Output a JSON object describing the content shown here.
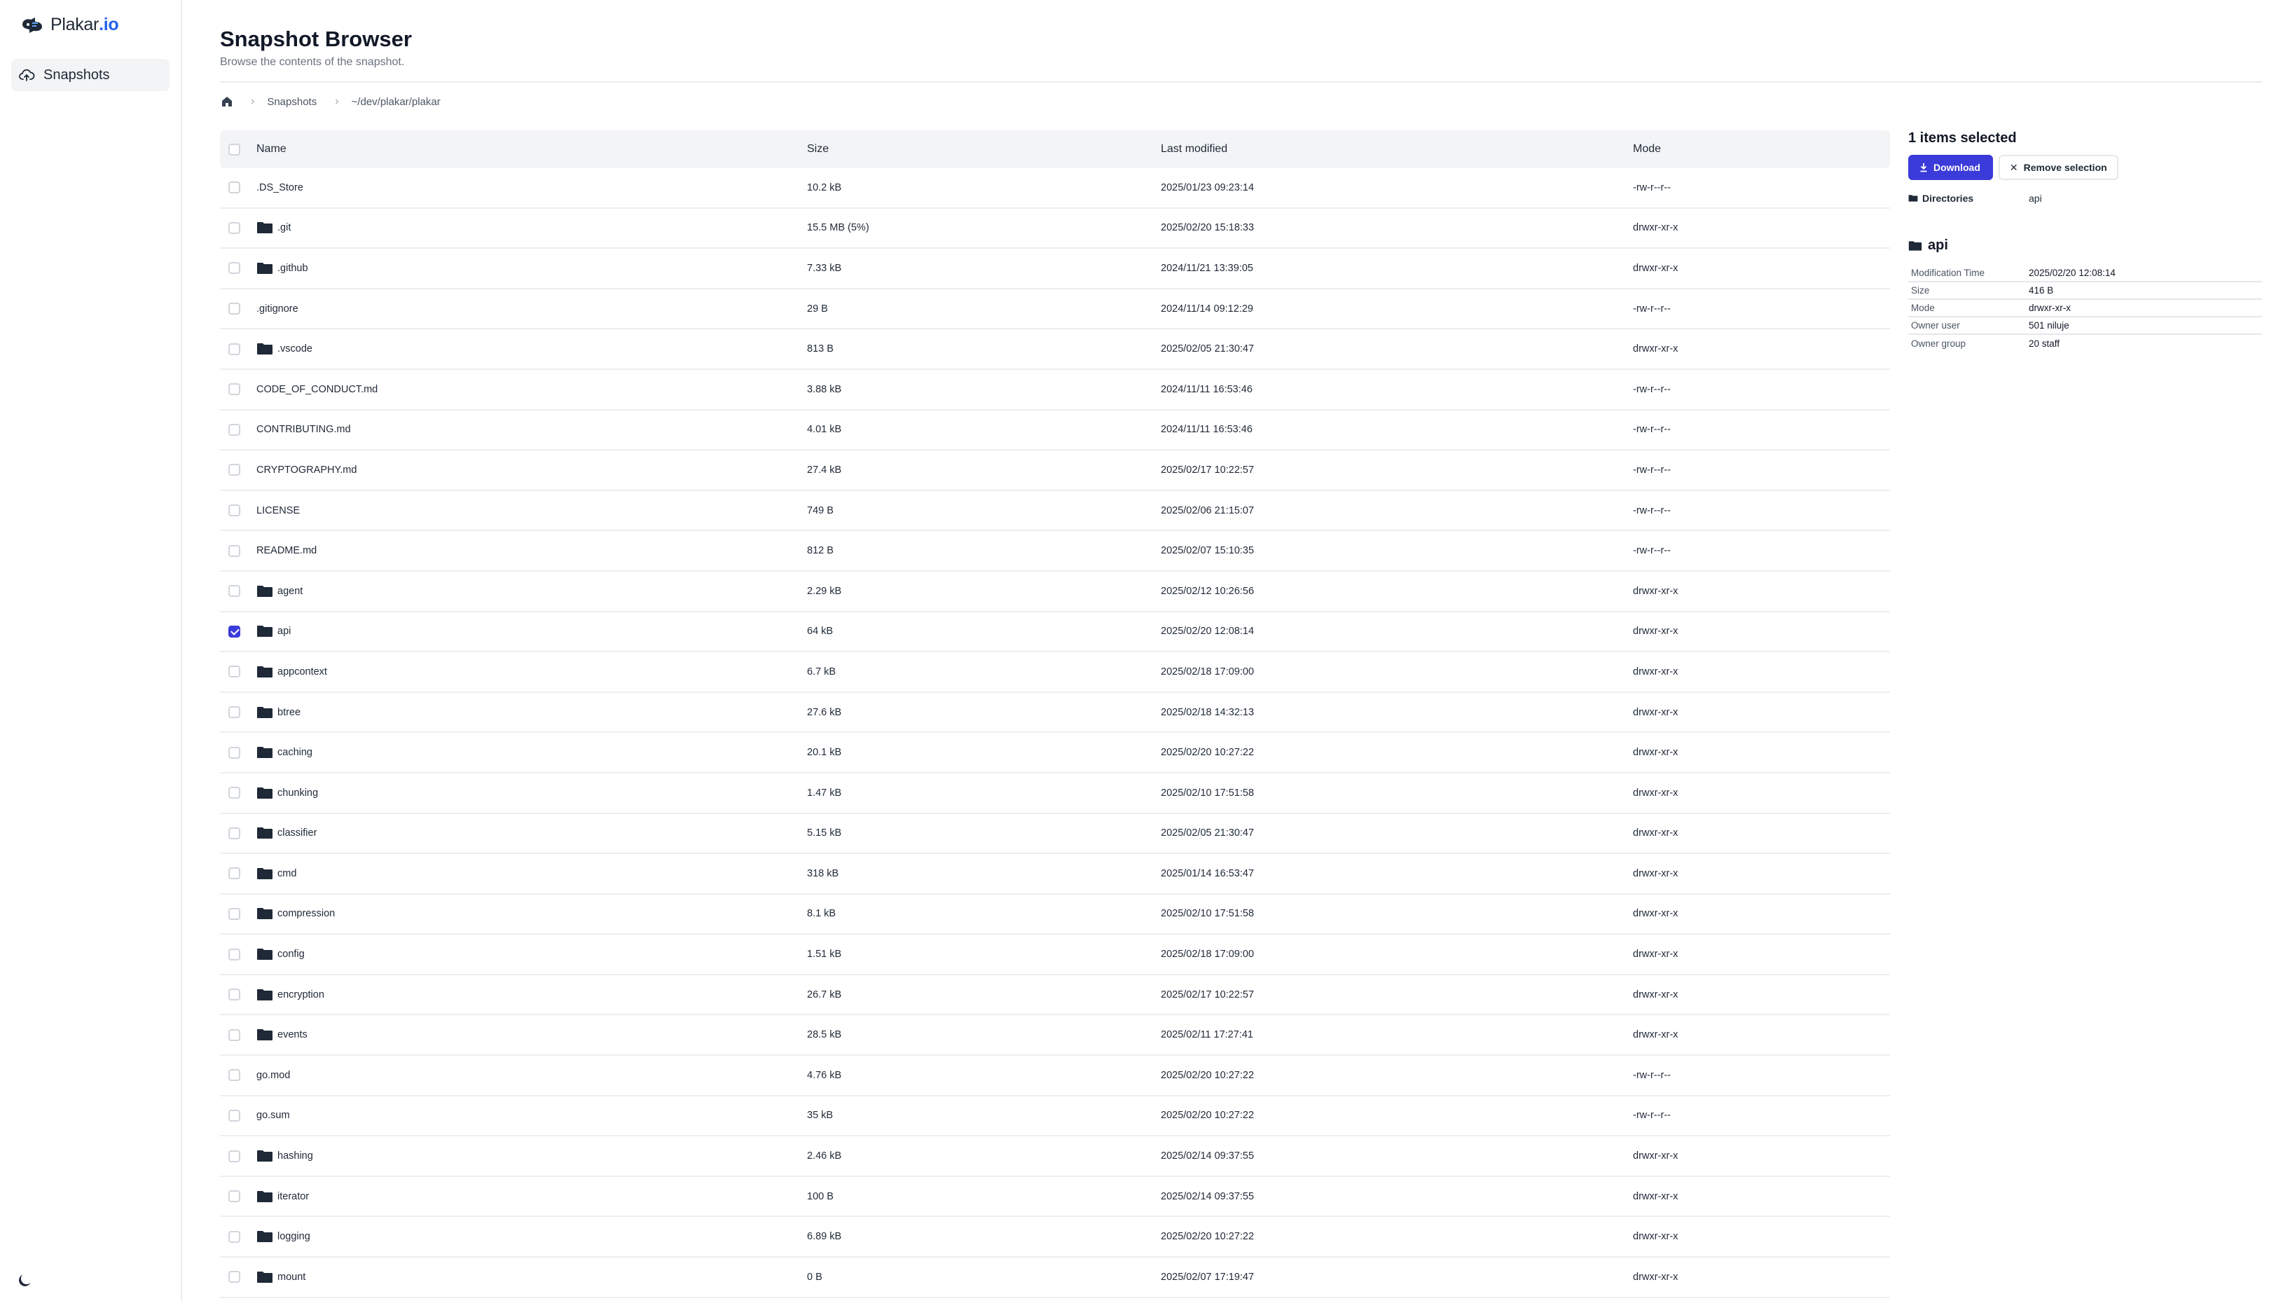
{
  "app": {
    "logo_text": "Plakar",
    "logo_accent": ".io"
  },
  "sidebar": {
    "items": [
      {
        "label": "Snapshots",
        "icon": "cloud-upload-icon"
      }
    ],
    "theme_icon": "moon-icon"
  },
  "header": {
    "title": "Snapshot Browser",
    "subtitle": "Browse the contents of the snapshot."
  },
  "breadcrumb": {
    "items": [
      "Snapshots",
      "~/dev/plakar/plakar"
    ]
  },
  "table": {
    "columns": [
      "Name",
      "Size",
      "Last modified",
      "Mode"
    ],
    "rows": [
      {
        "name": ".DS_Store",
        "size": "10.2 kB",
        "modified": "2025/01/23 09:23:14",
        "mode": "-rw-r--r--",
        "folder": false,
        "checked": false
      },
      {
        "name": ".git",
        "size": "15.5 MB (5%)",
        "modified": "2025/02/20 15:18:33",
        "mode": "drwxr-xr-x",
        "folder": true,
        "checked": false
      },
      {
        "name": ".github",
        "size": "7.33 kB",
        "modified": "2024/11/21 13:39:05",
        "mode": "drwxr-xr-x",
        "folder": true,
        "checked": false
      },
      {
        "name": ".gitignore",
        "size": "29 B",
        "modified": "2024/11/14 09:12:29",
        "mode": "-rw-r--r--",
        "folder": false,
        "checked": false
      },
      {
        "name": ".vscode",
        "size": "813 B",
        "modified": "2025/02/05 21:30:47",
        "mode": "drwxr-xr-x",
        "folder": true,
        "checked": false
      },
      {
        "name": "CODE_OF_CONDUCT.md",
        "size": "3.88 kB",
        "modified": "2024/11/11 16:53:46",
        "mode": "-rw-r--r--",
        "folder": false,
        "checked": false
      },
      {
        "name": "CONTRIBUTING.md",
        "size": "4.01 kB",
        "modified": "2024/11/11 16:53:46",
        "mode": "-rw-r--r--",
        "folder": false,
        "checked": false
      },
      {
        "name": "CRYPTOGRAPHY.md",
        "size": "27.4 kB",
        "modified": "2025/02/17 10:22:57",
        "mode": "-rw-r--r--",
        "folder": false,
        "checked": false
      },
      {
        "name": "LICENSE",
        "size": "749 B",
        "modified": "2025/02/06 21:15:07",
        "mode": "-rw-r--r--",
        "folder": false,
        "checked": false
      },
      {
        "name": "README.md",
        "size": "812 B",
        "modified": "2025/02/07 15:10:35",
        "mode": "-rw-r--r--",
        "folder": false,
        "checked": false
      },
      {
        "name": "agent",
        "size": "2.29 kB",
        "modified": "2025/02/12 10:26:56",
        "mode": "drwxr-xr-x",
        "folder": true,
        "checked": false
      },
      {
        "name": "api",
        "size": "64 kB",
        "modified": "2025/02/20 12:08:14",
        "mode": "drwxr-xr-x",
        "folder": true,
        "checked": true
      },
      {
        "name": "appcontext",
        "size": "6.7 kB",
        "modified": "2025/02/18 17:09:00",
        "mode": "drwxr-xr-x",
        "folder": true,
        "checked": false
      },
      {
        "name": "btree",
        "size": "27.6 kB",
        "modified": "2025/02/18 14:32:13",
        "mode": "drwxr-xr-x",
        "folder": true,
        "checked": false
      },
      {
        "name": "caching",
        "size": "20.1 kB",
        "modified": "2025/02/20 10:27:22",
        "mode": "drwxr-xr-x",
        "folder": true,
        "checked": false
      },
      {
        "name": "chunking",
        "size": "1.47 kB",
        "modified": "2025/02/10 17:51:58",
        "mode": "drwxr-xr-x",
        "folder": true,
        "checked": false
      },
      {
        "name": "classifier",
        "size": "5.15 kB",
        "modified": "2025/02/05 21:30:47",
        "mode": "drwxr-xr-x",
        "folder": true,
        "checked": false
      },
      {
        "name": "cmd",
        "size": "318 kB",
        "modified": "2025/01/14 16:53:47",
        "mode": "drwxr-xr-x",
        "folder": true,
        "checked": false
      },
      {
        "name": "compression",
        "size": "8.1 kB",
        "modified": "2025/02/10 17:51:58",
        "mode": "drwxr-xr-x",
        "folder": true,
        "checked": false
      },
      {
        "name": "config",
        "size": "1.51 kB",
        "modified": "2025/02/18 17:09:00",
        "mode": "drwxr-xr-x",
        "folder": true,
        "checked": false
      },
      {
        "name": "encryption",
        "size": "26.7 kB",
        "modified": "2025/02/17 10:22:57",
        "mode": "drwxr-xr-x",
        "folder": true,
        "checked": false
      },
      {
        "name": "events",
        "size": "28.5 kB",
        "modified": "2025/02/11 17:27:41",
        "mode": "drwxr-xr-x",
        "folder": true,
        "checked": false
      },
      {
        "name": "go.mod",
        "size": "4.76 kB",
        "modified": "2025/02/20 10:27:22",
        "mode": "-rw-r--r--",
        "folder": false,
        "checked": false
      },
      {
        "name": "go.sum",
        "size": "35 kB",
        "modified": "2025/02/20 10:27:22",
        "mode": "-rw-r--r--",
        "folder": false,
        "checked": false
      },
      {
        "name": "hashing",
        "size": "2.46 kB",
        "modified": "2025/02/14 09:37:55",
        "mode": "drwxr-xr-x",
        "folder": true,
        "checked": false
      },
      {
        "name": "iterator",
        "size": "100 B",
        "modified": "2025/02/14 09:37:55",
        "mode": "drwxr-xr-x",
        "folder": true,
        "checked": false
      },
      {
        "name": "logging",
        "size": "6.89 kB",
        "modified": "2025/02/20 10:27:22",
        "mode": "drwxr-xr-x",
        "folder": true,
        "checked": false
      },
      {
        "name": "mount",
        "size": "0 B",
        "modified": "2025/02/07 17:19:47",
        "mode": "drwxr-xr-x",
        "folder": true,
        "checked": false
      }
    ]
  },
  "selection": {
    "title": "1 items selected",
    "download_label": "Download",
    "remove_label": "Remove selection",
    "directories_label": "Directories",
    "directories_value": "api"
  },
  "details": {
    "title": "api",
    "props": [
      {
        "key": "Modification Time",
        "value": "2025/02/20 12:08:14"
      },
      {
        "key": "Size",
        "value": "416 B"
      },
      {
        "key": "Mode",
        "value": "drwxr-xr-x"
      },
      {
        "key": "Owner user",
        "value": "501 niluje"
      },
      {
        "key": "Owner group",
        "value": "20 staff"
      }
    ]
  },
  "colors": {
    "accent": "#3b3bd9",
    "brand": "#2563eb"
  }
}
